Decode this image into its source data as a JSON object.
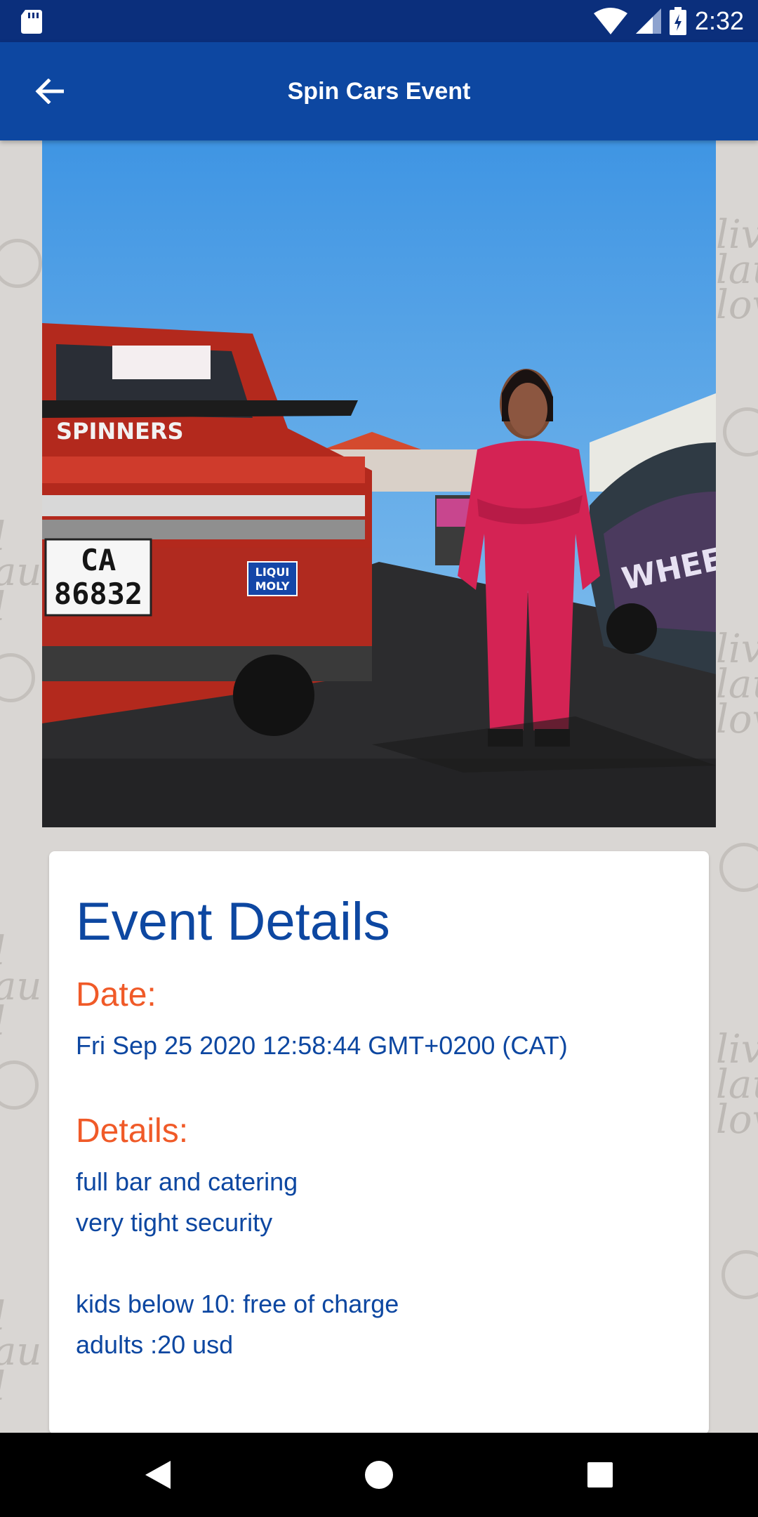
{
  "status_bar": {
    "time": "2:32",
    "icons": [
      "sd-card-icon",
      "wifi-icon",
      "signal-icon",
      "battery-charging-icon"
    ]
  },
  "app_bar": {
    "title": "Spin Cars Event",
    "back_icon": "arrow-left-icon"
  },
  "hero_image": {
    "plate_line1": "CA",
    "plate_line2": "86832",
    "sticker_line1": "LIQUI",
    "sticker_line2": "MOLY",
    "banner_text": "SPINNERS"
  },
  "event": {
    "heading": "Event Details",
    "date_label": "Date:",
    "date_value": "Fri Sep 25 2020 12:58:44 GMT+0200 (CAT)",
    "details_label": "Details:",
    "details_text": "full bar and catering\nvery tight security\n\nkids below 10:  free of charge\nadults :20 usd"
  },
  "nav_bar": {
    "buttons": [
      "back-triangle-icon",
      "home-circle-icon",
      "recents-square-icon"
    ]
  },
  "colors": {
    "primary": "#0d47a1",
    "status_bar": "#0b2f7c",
    "accent": "#f05a28",
    "background": "#d9d6d3"
  }
}
